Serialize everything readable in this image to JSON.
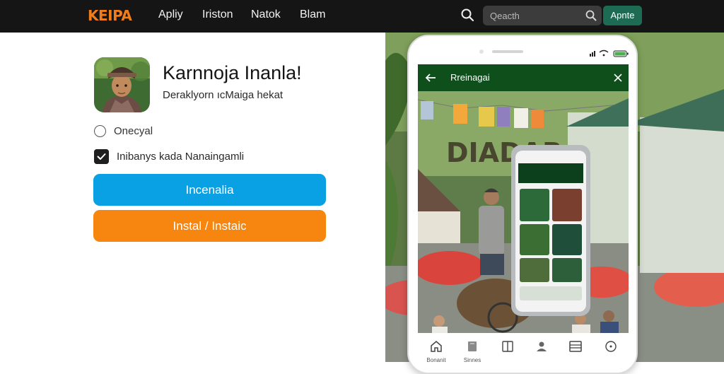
{
  "nav": {
    "logo": "KEIPA",
    "links": [
      "Apliy",
      "Iriston",
      "Natok",
      "Blam"
    ],
    "search_placeholder": "Qeacth",
    "cta": "Apnte"
  },
  "profile": {
    "title": "Karnnoja Inanla!",
    "subtitle": "Deraklyorn ıcMaiga hekat"
  },
  "options": {
    "radio_label": "Onecyal",
    "checkbox_label": "Inibanys kada Nanaingamli",
    "checkbox_checked": true
  },
  "buttons": {
    "primary": "Incenalia",
    "secondary": "Instal / Instaiс"
  },
  "phone_app": {
    "bar_title": "Rreinagai",
    "banner_text": "DIADAR",
    "bottom_nav": [
      "Bonanit",
      "Sinnes",
      "",
      "",
      "",
      ""
    ]
  },
  "colors": {
    "nav_bg": "#151515",
    "logo": "#f07c1a",
    "cta": "#1d6b52",
    "primary_button": "#0aa0e4",
    "secondary_button": "#f6860f",
    "app_bar": "#0e4f1c"
  }
}
